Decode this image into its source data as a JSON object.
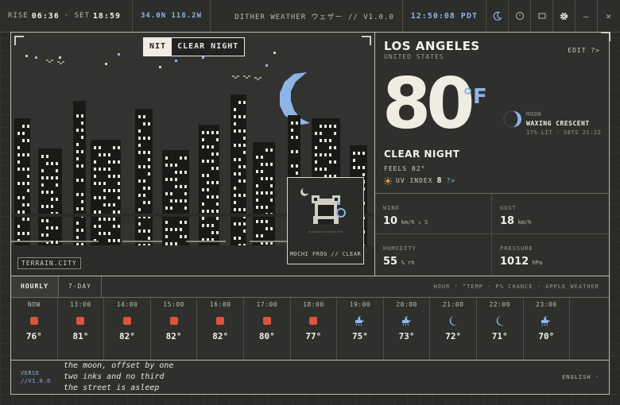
{
  "topbar": {
    "rise_label": "RISE",
    "rise_time": "06:36",
    "set_label": "· SET",
    "set_time": "18:59",
    "coords": "34.0N 118.2W",
    "title": "DITHER WEATHER ウェザー // V1.0.0",
    "clock": "12:50:08 PDT",
    "icons": [
      "moon-icon",
      "clock-icon",
      "window-icon",
      "gear-icon",
      "minimize-icon",
      "close-icon"
    ],
    "minimize": "–",
    "close": "×"
  },
  "scene": {
    "chip_tag": "NIT",
    "chip_text": "CLEAR NIGHT",
    "terrain": "TERRAIN.CITY",
    "frog_label": "MOCHI FROG // CLEAR"
  },
  "side": {
    "city": "LOS ANGELES",
    "country": "UNITED STATES",
    "edit": "EDIT ?>",
    "temp": "80",
    "unit": "°F",
    "moon_label": "MOON",
    "moon_phase": "WAXING CRESCENT",
    "moon_detail": "17% LIT · SETS 21:22",
    "condition": "CLEAR NIGHT",
    "feels": "FEELS 82°",
    "uv_label": "UV INDEX",
    "uv_value": "8",
    "uv_more": "?>"
  },
  "stats": [
    {
      "label": "WIND",
      "value": "10",
      "unit": "km/h ↓ S"
    },
    {
      "label": "GUST",
      "value": "18",
      "unit": "km/h"
    },
    {
      "label": "HUMIDITY",
      "value": "55",
      "unit": "% rh"
    },
    {
      "label": "PRESSURE",
      "value": "1012",
      "unit": "hPa"
    }
  ],
  "tabs": [
    "HOURLY",
    "7-DAY"
  ],
  "legend": "HOUR · °TEMP · P% CHANCE · APPLE WEATHER",
  "hourly": [
    {
      "time": "NOW",
      "icon": "sun-icon",
      "temp": "76°"
    },
    {
      "time": "13:00",
      "icon": "sun-icon",
      "temp": "81°"
    },
    {
      "time": "14:00",
      "icon": "sun-icon",
      "temp": "82°"
    },
    {
      "time": "15:00",
      "icon": "sun-icon",
      "temp": "82°"
    },
    {
      "time": "16:00",
      "icon": "sun-icon",
      "temp": "82°"
    },
    {
      "time": "17:00",
      "icon": "sun-icon",
      "temp": "80°"
    },
    {
      "time": "18:00",
      "icon": "sun-icon",
      "temp": "77°"
    },
    {
      "time": "19:00",
      "icon": "partly-cloudy-night-icon",
      "temp": "75°"
    },
    {
      "time": "20:00",
      "icon": "partly-cloudy-night-icon",
      "temp": "73°"
    },
    {
      "time": "21:00",
      "icon": "moon-icon",
      "temp": "72°"
    },
    {
      "time": "22:00",
      "icon": "moon-icon",
      "temp": "71°"
    },
    {
      "time": "23:00",
      "icon": "partly-cloudy-night-icon",
      "temp": "70°"
    }
  ],
  "verse": {
    "label1": "VERSE",
    "label2": "//V1.0.0",
    "lines": [
      "the moon, offset by one",
      "two inks and no third",
      "the street is asleep"
    ],
    "language": "ENGLISH ·"
  },
  "colors": {
    "accent": "#8fb4e8",
    "sun": "#e0533a",
    "panel": "#2f2f2d"
  }
}
